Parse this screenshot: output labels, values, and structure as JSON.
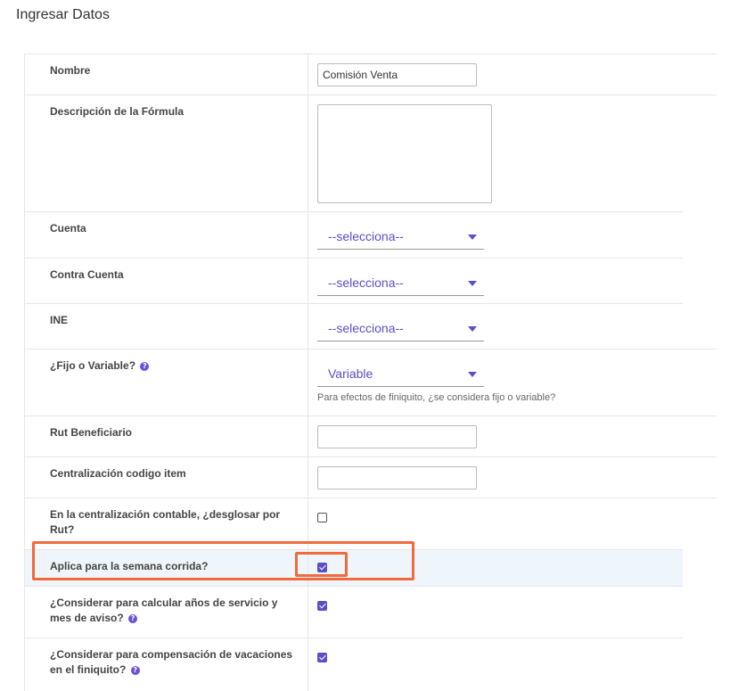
{
  "header": {
    "title": "Ingresar Datos"
  },
  "form": {
    "nombre": {
      "label": "Nombre",
      "value": "Comisión Venta"
    },
    "descripcion": {
      "label": "Descripción de la Fórmula",
      "value": ""
    },
    "cuenta": {
      "label": "Cuenta",
      "selected": "--selecciona--"
    },
    "contra_cuenta": {
      "label": "Contra Cuenta",
      "selected": "--selecciona--"
    },
    "ine": {
      "label": "INE",
      "selected": "--selecciona--"
    },
    "fijo_variable": {
      "label": "¿Fijo o Variable?",
      "selected": "Variable",
      "help": "Para efectos de finiquito, ¿se considera fijo o variable?"
    },
    "rut_beneficiario": {
      "label": "Rut Beneficiario",
      "value": ""
    },
    "centralizacion_item": {
      "label": "Centralización codigo item",
      "value": ""
    },
    "desglosar_rut": {
      "label": "En la centralización contable, ¿desglosar por Rut?",
      "checked": false
    },
    "semana_corrida": {
      "label": "Aplica para la semana corrida?",
      "checked": true
    },
    "anos_servicio": {
      "label": "¿Considerar para calcular años de servicio y mes de aviso?",
      "checked": true
    },
    "compensacion_vacaciones": {
      "label": "¿Considerar para compensación de vacaciones en el finiquito?",
      "checked": true
    }
  },
  "icons": {
    "help": "question-circle-icon",
    "caret": "caret-down-icon"
  },
  "colors": {
    "accent": "#5b4fc7",
    "highlight": "#eef6fb",
    "annotation": "#f26a3a"
  }
}
